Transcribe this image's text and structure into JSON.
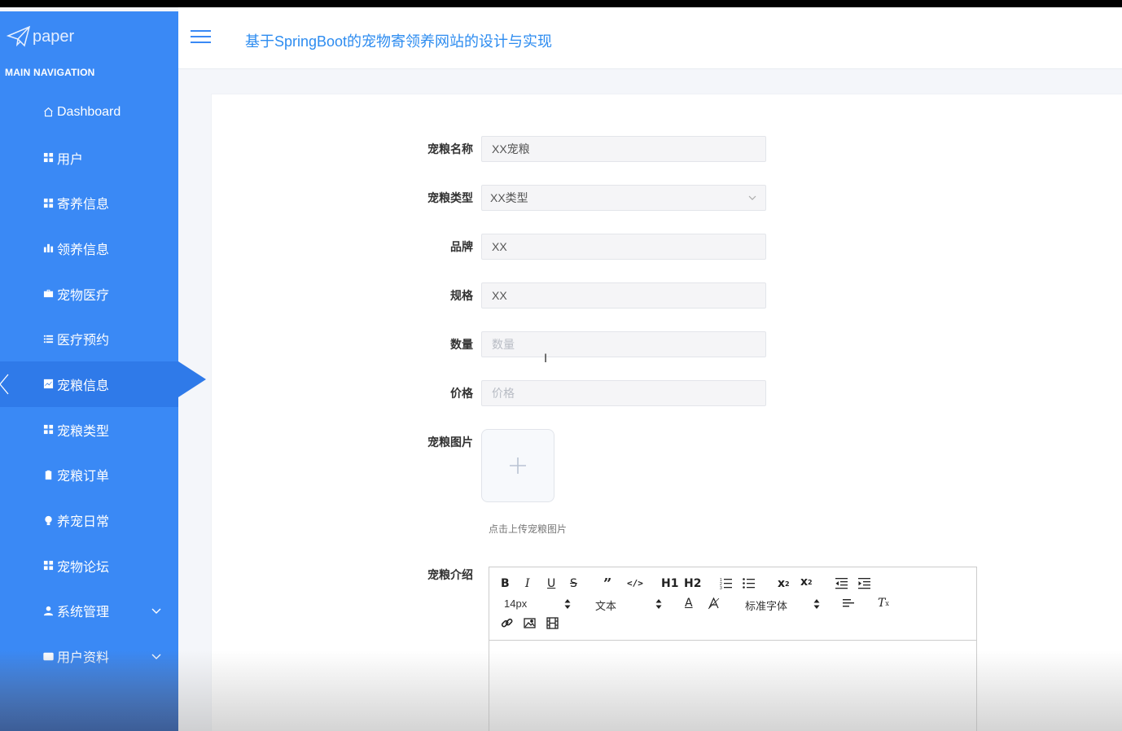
{
  "app": {
    "logo_text": "paper",
    "title": "基于SpringBoot的宠物寄领养网站的设计与实现"
  },
  "sidebar": {
    "section_label": "MAIN NAVIGATION",
    "items": [
      {
        "label": "Dashboard",
        "icon": "home-icon"
      },
      {
        "label": "用户",
        "icon": "grid-icon"
      },
      {
        "label": "寄养信息",
        "icon": "grid-icon"
      },
      {
        "label": "领养信息",
        "icon": "bar-chart-icon"
      },
      {
        "label": "宠物医疗",
        "icon": "briefcase-icon"
      },
      {
        "label": "医疗预约",
        "icon": "list-icon"
      },
      {
        "label": "宠粮信息",
        "icon": "line-chart-icon",
        "active": true
      },
      {
        "label": "宠粮类型",
        "icon": "grid-icon"
      },
      {
        "label": "宠粮订单",
        "icon": "clipboard-icon"
      },
      {
        "label": "养宠日常",
        "icon": "bulb-icon"
      },
      {
        "label": "宠物论坛",
        "icon": "grid-icon"
      },
      {
        "label": "系统管理",
        "icon": "user-icon",
        "expandable": true
      },
      {
        "label": "用户资料",
        "icon": "card-icon",
        "expandable": true
      }
    ]
  },
  "form": {
    "name_label": "宠粮名称",
    "name_value": "XX宠粮",
    "type_label": "宠粮类型",
    "type_value": "XX类型",
    "brand_label": "品牌",
    "brand_value": "XX",
    "spec_label": "规格",
    "spec_value": "XX",
    "qty_label": "数量",
    "qty_placeholder": "数量",
    "price_label": "价格",
    "price_placeholder": "价格",
    "image_label": "宠粮图片",
    "upload_hint": "点击上传宠粮图片",
    "intro_label": "宠粮介绍"
  },
  "editor": {
    "font_size": "14px",
    "paragraph": "文本",
    "font_family": "标准字体",
    "h1": "H1",
    "h2": "H2"
  },
  "colors": {
    "sidebar": "#3a89f5",
    "sidebar_active": "#2f7ae9",
    "title": "#2d8cf0"
  }
}
